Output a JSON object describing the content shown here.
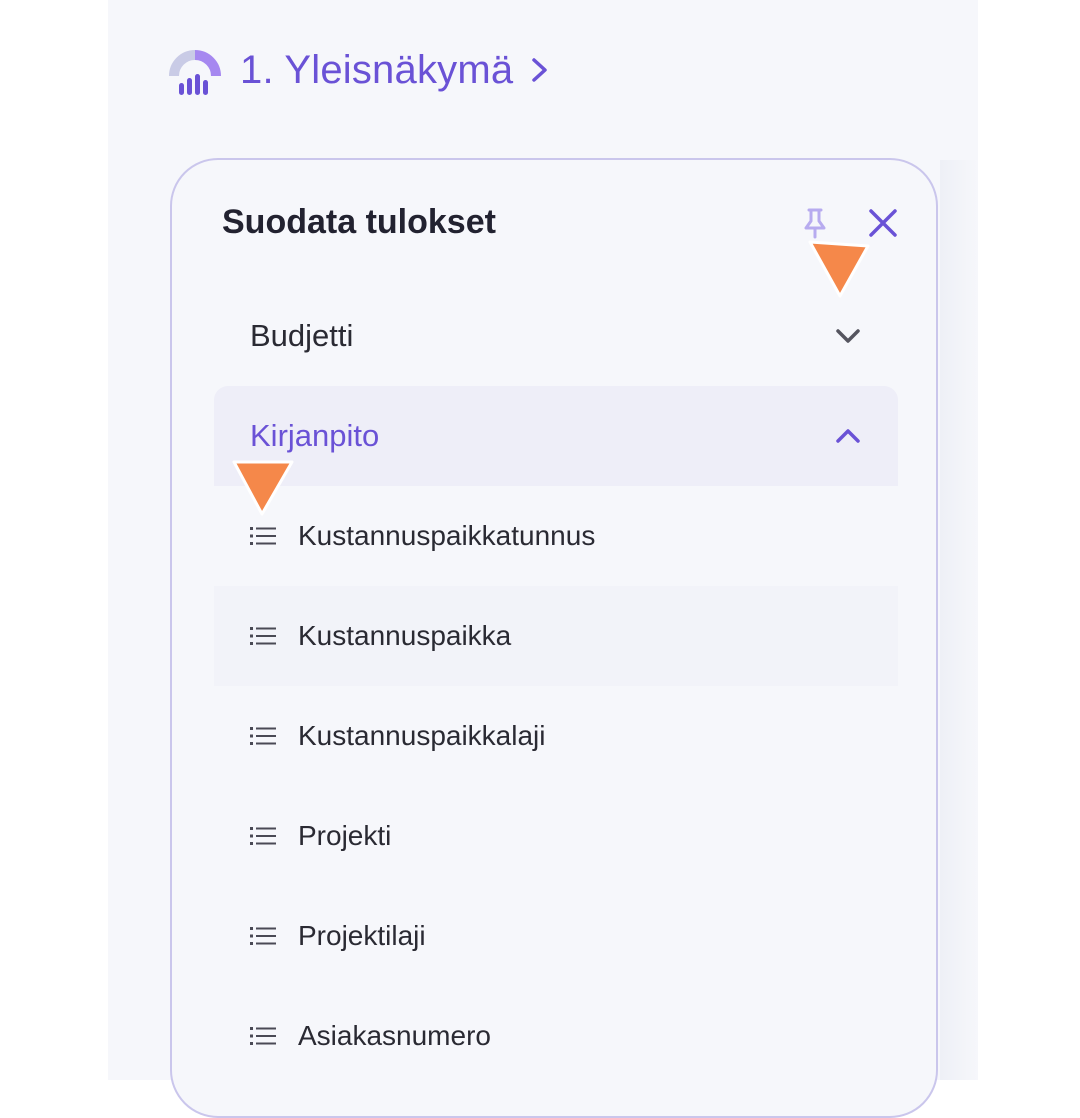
{
  "header": {
    "title": "1. Yleisnäkymä",
    "logo_icon": "analytics-logo-icon",
    "chevron_icon": "chevron-right-icon"
  },
  "filter_panel": {
    "title": "Suodata tulokset",
    "pin_icon": "pin-icon",
    "close_icon": "close-icon",
    "sections": [
      {
        "label": "Budjetti",
        "expanded": false,
        "icon": "chevron-down-icon"
      },
      {
        "label": "Kirjanpito",
        "expanded": true,
        "icon": "chevron-up-icon"
      }
    ],
    "items": [
      {
        "label": "Kustannuspaikkatunnus",
        "icon": "list-icon"
      },
      {
        "label": "Kustannuspaikka",
        "icon": "list-icon"
      },
      {
        "label": "Kustannuspaikkalaji",
        "icon": "list-icon"
      },
      {
        "label": "Projekti",
        "icon": "list-icon"
      },
      {
        "label": "Projektilaji",
        "icon": "list-icon"
      },
      {
        "label": "Asiakasnumero",
        "icon": "list-icon"
      }
    ]
  },
  "colors": {
    "accent": "#6a52d6",
    "pointer": "#f5884a",
    "background": "#f6f7fb",
    "card_border": "#cac6ec"
  }
}
